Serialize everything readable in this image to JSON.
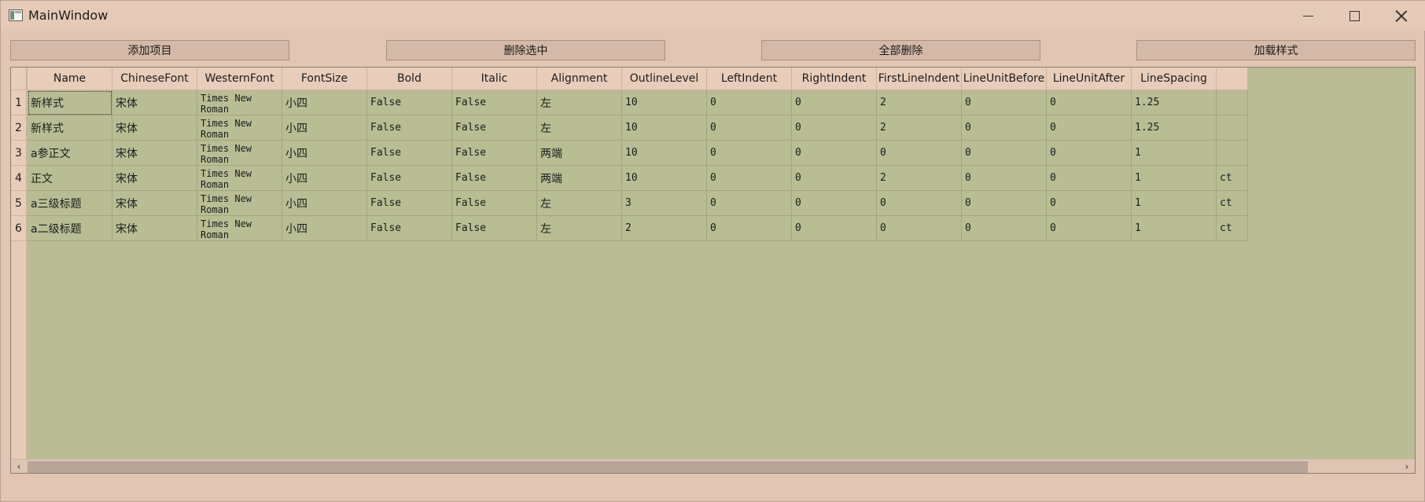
{
  "window": {
    "title": "MainWindow"
  },
  "toolbar": {
    "add": "添加项目",
    "delete_selected": "删除选中",
    "delete_all": "全部删除",
    "load_style": "加载样式"
  },
  "table": {
    "columns": [
      "Name",
      "ChineseFont",
      "WesternFont",
      "FontSize",
      "Bold",
      "Italic",
      "Alignment",
      "OutlineLevel",
      "LeftIndent",
      "RightIndent",
      "FirstLineIndent",
      "LineUnitBefore",
      "LineUnitAfter",
      "LineSpacing"
    ],
    "row_numbers": [
      "1",
      "2",
      "3",
      "4",
      "5",
      "6"
    ],
    "rows": [
      [
        "新样式",
        "宋体",
        "Times New Roman",
        "小四",
        "False",
        "False",
        "左",
        "10",
        "0",
        "0",
        "2",
        "0",
        "0",
        "1.25",
        ""
      ],
      [
        "新样式",
        "宋体",
        "Times New Roman",
        "小四",
        "False",
        "False",
        "左",
        "10",
        "0",
        "0",
        "2",
        "0",
        "0",
        "1.25",
        ""
      ],
      [
        "a参正文",
        "宋体",
        "Times New Roman",
        "小四",
        "False",
        "False",
        "两端",
        "10",
        "0",
        "0",
        "0",
        "0",
        "0",
        "1",
        ""
      ],
      [
        "正文",
        "宋体",
        "Times New Roman",
        "小四",
        "False",
        "False",
        "两端",
        "10",
        "0",
        "0",
        "2",
        "0",
        "0",
        "1",
        "ct"
      ],
      [
        "a三级标题",
        "宋体",
        "Times New Roman",
        "小四",
        "False",
        "False",
        "左",
        "3",
        "0",
        "0",
        "0",
        "0",
        "0",
        "1",
        "ct"
      ],
      [
        "a二级标题",
        "宋体",
        "Times New Roman",
        "小四",
        "False",
        "False",
        "左",
        "2",
        "0",
        "0",
        "0",
        "0",
        "0",
        "1",
        "ct"
      ]
    ]
  },
  "scrollbar": {
    "left_arrow": "‹",
    "right_arrow": "›"
  },
  "colors": {
    "window_bg": "#e2c5b2",
    "table_bg": "#b9bd94",
    "header_bg": "#e8cdbb"
  }
}
